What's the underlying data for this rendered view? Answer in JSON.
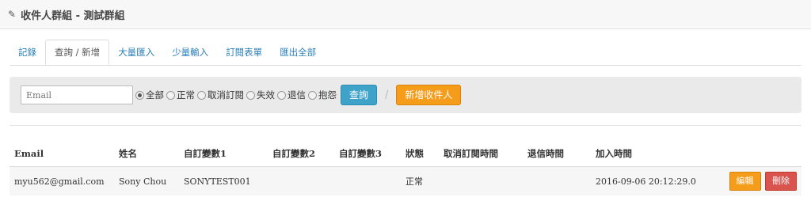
{
  "header": {
    "title": "收件人群組 - 測試群組"
  },
  "tabs": [
    "記錄",
    "查詢 / 新增",
    "大量匯入",
    "少量輸入",
    "訂閱表單",
    "匯出全部"
  ],
  "filter": {
    "email_placeholder": "Email",
    "radios": [
      "全部",
      "正常",
      "取消訂閱",
      "失效",
      "退信",
      "抱怨"
    ],
    "selected": "全部",
    "query_label": "查詢",
    "separator": "/",
    "add_label": "新增收件人"
  },
  "table": {
    "headers": [
      "Email",
      "姓名",
      "自訂變數1",
      "自訂變數2",
      "自訂變數3",
      "狀態",
      "取消訂閱時間",
      "退信時間",
      "加入時間"
    ],
    "rows": [
      {
        "email": "myu562@gmail.com",
        "name": "Sony Chou",
        "var1": "SONYTEST001",
        "var2": "",
        "var3": "",
        "status": "正常",
        "unsub_time": "",
        "bounce_time": "",
        "join_time": "2016-09-06 20:12:29.0",
        "edit_label": "編輯",
        "delete_label": "刪除"
      }
    ]
  },
  "colors": {
    "accent": "#3ea2c9",
    "orange": "#f59c1a",
    "danger": "#d9534f",
    "link": "#2a7fb8"
  }
}
